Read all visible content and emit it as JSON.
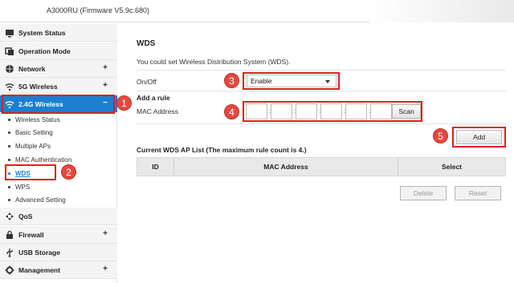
{
  "header": {
    "firmware": "A3000RU (Firmware V5.9c.680)"
  },
  "sidebar": {
    "items": [
      {
        "label": "System Status",
        "icon": "monitor-icon",
        "expand": ""
      },
      {
        "label": "Operation Mode",
        "icon": "mode-icon",
        "expand": ""
      },
      {
        "label": "Network",
        "icon": "globe-icon",
        "expand": "+"
      },
      {
        "label": "5G Wireless",
        "icon": "wifi-icon",
        "expand": "+"
      },
      {
        "label": "2.4G Wireless",
        "icon": "wifi-icon",
        "expand": "−"
      },
      {
        "label": "QoS",
        "icon": "qos-icon",
        "expand": ""
      },
      {
        "label": "Firewall",
        "icon": "lock-icon",
        "expand": "+"
      },
      {
        "label": "USB Storage",
        "icon": "usb-icon",
        "expand": ""
      },
      {
        "label": "Management",
        "icon": "gear-icon",
        "expand": "+"
      }
    ],
    "sub_items": [
      {
        "label": "Wireless Status"
      },
      {
        "label": "Basic Setting"
      },
      {
        "label": "Multiple APs"
      },
      {
        "label": "MAC Authentication"
      },
      {
        "label": "WDS"
      },
      {
        "label": "WPS"
      },
      {
        "label": "Advanced Setting"
      }
    ]
  },
  "main": {
    "title": "WDS",
    "description": "You could set Wireless Distribution System (WDS).",
    "onoff_label": "On/Off",
    "onoff_value": "Enable",
    "add_rule_label": "Add a rule",
    "mac_label": "MAC Address",
    "mac_separator": ":",
    "scan_button": "Scan",
    "add_button": "Add",
    "list_title": "Current WDS AP List (The maximum rule count is 4.)",
    "table_headers": [
      "ID",
      "MAC Address",
      "Select"
    ],
    "delete_button": "Delete",
    "reset_button": "Reset"
  },
  "annotations": {
    "steps": [
      "1",
      "2",
      "3",
      "4",
      "5"
    ],
    "color": "#e02020"
  }
}
